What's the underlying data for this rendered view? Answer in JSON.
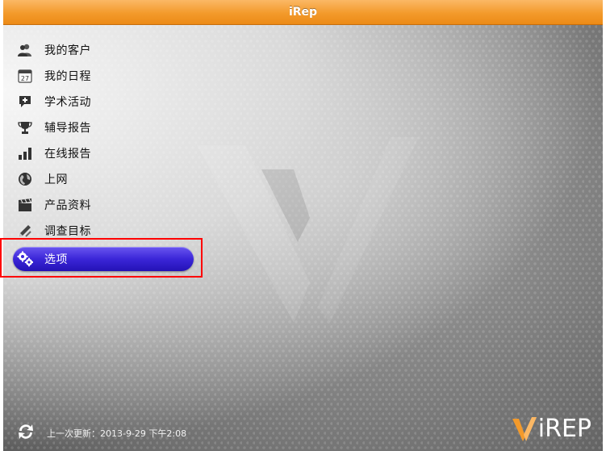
{
  "app": {
    "title": "iRep"
  },
  "menu": {
    "items": [
      {
        "label": "我的客户",
        "icon": "customers-icon"
      },
      {
        "label": "我的日程",
        "icon": "calendar-icon",
        "calendar_day": "27"
      },
      {
        "label": "学术活动",
        "icon": "plus-bubble-icon"
      },
      {
        "label": "辅导报告",
        "icon": "trophy-icon"
      },
      {
        "label": "在线报告",
        "icon": "bar-chart-icon"
      },
      {
        "label": "上网",
        "icon": "globe-icon"
      },
      {
        "label": "产品资料",
        "icon": "clapperboard-icon"
      },
      {
        "label": "调查目标",
        "icon": "pencil-ruler-icon"
      },
      {
        "label": "选项",
        "icon": "gears-icon",
        "selected": true
      }
    ]
  },
  "footer": {
    "sync_text": "上一次更新：2013-9-29 下午2:08"
  },
  "logo": {
    "text": "iREP",
    "accent_color": "#f39a2b"
  },
  "colors": {
    "titlebar": "#f39a2b",
    "selected_item": "#3b26d8",
    "annotation_box": "#ff0000"
  }
}
